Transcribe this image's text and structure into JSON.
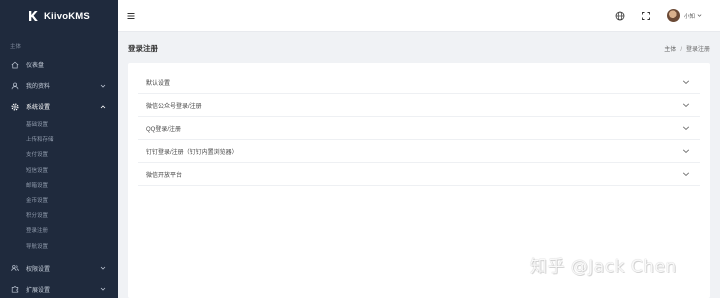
{
  "brand": {
    "name": "KiivoKMS"
  },
  "sidebar": {
    "section_label": "主体",
    "items": [
      {
        "label": "仪表盘",
        "icon": "home-icon",
        "has_children": false
      },
      {
        "label": "我的资料",
        "icon": "user-icon",
        "has_children": true
      },
      {
        "label": "系统设置",
        "icon": "gear-icon",
        "has_children": true,
        "active": true,
        "children": [
          "基础设置",
          "上传和存储",
          "支付设置",
          "短信设置",
          "邮箱设置",
          "金币设置",
          "积分设置",
          "登录注册",
          "导航设置"
        ]
      },
      {
        "label": "权限设置",
        "icon": "users-icon",
        "has_children": true
      },
      {
        "label": "扩展设置",
        "icon": "puzzle-icon",
        "has_children": true
      }
    ]
  },
  "topbar": {
    "menu_icon": "hamburger-icon",
    "globe_icon": "globe-icon",
    "fullscreen_icon": "fullscreen-icon",
    "username": "小知"
  },
  "page": {
    "title": "登录注册",
    "breadcrumb": {
      "root": "主体",
      "separator": "/",
      "current": "登录注册"
    }
  },
  "accordion": [
    {
      "label": "默认设置"
    },
    {
      "label": "微信公众号登录/注册"
    },
    {
      "label": "QQ登录/注册"
    },
    {
      "label": "钉钉登录/注册（钉钉内置浏览器）"
    },
    {
      "label": "微信开放平台"
    }
  ],
  "watermark": "知乎 @Jack Chen",
  "colors": {
    "sidebar_bg": "#1f2a3d",
    "page_bg": "#f0f2f5",
    "card_bg": "#ffffff"
  }
}
